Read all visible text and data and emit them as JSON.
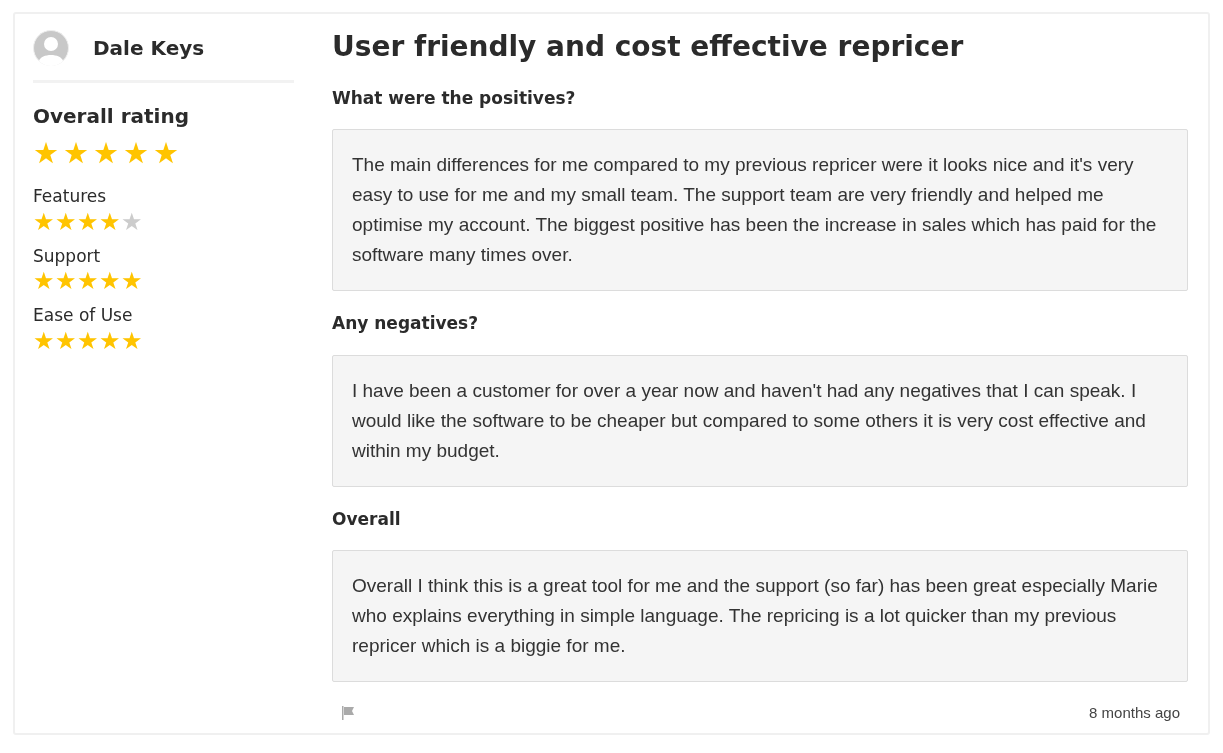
{
  "reviewer": {
    "name": "Dale Keys"
  },
  "overall": {
    "label": "Overall rating",
    "stars": 5
  },
  "ratings": [
    {
      "label": "Features",
      "stars": 4
    },
    {
      "label": "Support",
      "stars": 5
    },
    {
      "label": "Ease of Use",
      "stars": 5
    }
  ],
  "title": "User friendly and cost effective repricer",
  "sections": [
    {
      "heading": "What were the positives?",
      "text": "The main differences for me compared to my previous repricer were it looks nice and it's very easy to use for me and my small team. The support team are very friendly and helped me optimise my account. The biggest positive has been the increase in sales which has paid for the software many times over."
    },
    {
      "heading": "Any negatives?",
      "text": "I have been a customer for over a year now and haven't had any negatives that I can speak. I would like the software to be cheaper but compared to some others it is very cost effective and within my budget."
    },
    {
      "heading": "Overall",
      "text": "Overall I think this is a great tool for me and the support (so far) has been great especially Marie who explains everything in simple language. The repricing is a lot quicker than my previous repricer which is a biggie for me."
    }
  ],
  "footer": {
    "time": "8 months ago"
  }
}
